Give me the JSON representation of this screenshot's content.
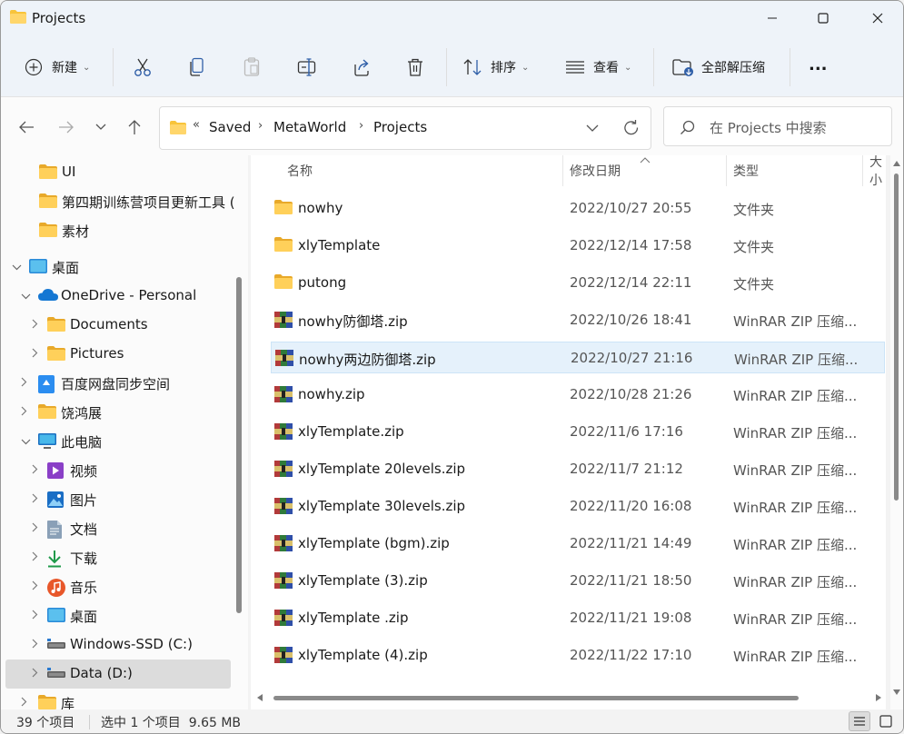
{
  "window": {
    "title": "Projects",
    "controls": [
      "minimize",
      "maximize",
      "close"
    ]
  },
  "toolbar": {
    "new_label": "新建",
    "sort_label": "排序",
    "view_label": "查看",
    "extract_label": "全部解压缩",
    "more_label": "..."
  },
  "address": {
    "overflow": "«",
    "crumbs": [
      "Saved",
      "MetaWorld",
      "Projects"
    ]
  },
  "search": {
    "placeholder": "在 Projects 中搜索"
  },
  "sidebar": {
    "items": [
      {
        "label": "UI",
        "icon": "folder-icon"
      },
      {
        "label": "第四期训练营项目更新工具 (",
        "icon": "folder-icon"
      },
      {
        "label": "素材",
        "icon": "folder-icon"
      },
      {
        "label": "桌面",
        "icon": "desktop-icon"
      },
      {
        "label": "OneDrive - Personal",
        "icon": "cloud-icon"
      },
      {
        "label": "Documents",
        "icon": "folder-icon"
      },
      {
        "label": "Pictures",
        "icon": "folder-icon"
      },
      {
        "label": "百度网盘同步空间",
        "icon": "baidu-icon"
      },
      {
        "label": "饶鸿展",
        "icon": "folder-icon"
      },
      {
        "label": "此电脑",
        "icon": "computer-icon"
      },
      {
        "label": "视频",
        "icon": "video-icon"
      },
      {
        "label": "图片",
        "icon": "picture-icon"
      },
      {
        "label": "文档",
        "icon": "document-icon"
      },
      {
        "label": "下载",
        "icon": "download-icon"
      },
      {
        "label": "音乐",
        "icon": "music-icon"
      },
      {
        "label": "桌面",
        "icon": "desktop-icon"
      },
      {
        "label": "Windows-SSD (C:)",
        "icon": "drive-icon"
      },
      {
        "label": "Data (D:)",
        "icon": "drive-icon"
      },
      {
        "label": "库",
        "icon": "folder-icon"
      }
    ]
  },
  "columns": {
    "name": "名称",
    "date": "修改日期",
    "type": "类型",
    "size": "大小"
  },
  "files": [
    {
      "name": "nowhy",
      "date": "2022/10/27 20:55",
      "type": "文件夹",
      "kind": "folder"
    },
    {
      "name": "xlyTemplate",
      "date": "2022/12/14 17:58",
      "type": "文件夹",
      "kind": "folder"
    },
    {
      "name": "putong",
      "date": "2022/12/14 22:11",
      "type": "文件夹",
      "kind": "folder"
    },
    {
      "name": "nowhy防御塔.zip",
      "date": "2022/10/26 18:41",
      "type": "WinRAR ZIP 压缩...",
      "kind": "zip"
    },
    {
      "name": "nowhy两边防御塔.zip",
      "date": "2022/10/27 21:16",
      "type": "WinRAR ZIP 压缩...",
      "kind": "zip"
    },
    {
      "name": "nowhy.zip",
      "date": "2022/10/28 21:26",
      "type": "WinRAR ZIP 压缩...",
      "kind": "zip"
    },
    {
      "name": "xlyTemplate.zip",
      "date": "2022/11/6 17:16",
      "type": "WinRAR ZIP 压缩...",
      "kind": "zip"
    },
    {
      "name": "xlyTemplate 20levels.zip",
      "date": "2022/11/7 21:12",
      "type": "WinRAR ZIP 压缩...",
      "kind": "zip"
    },
    {
      "name": "xlyTemplate 30levels.zip",
      "date": "2022/11/20 16:08",
      "type": "WinRAR ZIP 压缩...",
      "kind": "zip"
    },
    {
      "name": "xlyTemplate (bgm).zip",
      "date": "2022/11/21 14:49",
      "type": "WinRAR ZIP 压缩...",
      "kind": "zip"
    },
    {
      "name": "xlyTemplate (3).zip",
      "date": "2022/11/21 18:50",
      "type": "WinRAR ZIP 压缩...",
      "kind": "zip"
    },
    {
      "name": "xlyTemplate .zip",
      "date": "2022/11/21 19:08",
      "type": "WinRAR ZIP 压缩...",
      "kind": "zip"
    },
    {
      "name": "xlyTemplate (4).zip",
      "date": "2022/11/22 17:10",
      "type": "WinRAR ZIP 压缩...",
      "kind": "zip"
    }
  ],
  "selected_file_index": 4,
  "status": {
    "count": "39 个项目",
    "selection": "选中 1 个项目  9.65 MB"
  },
  "colors": {
    "accent": "#0067c0",
    "folder": "#f8c43a",
    "selection": "#e5f1fb"
  }
}
